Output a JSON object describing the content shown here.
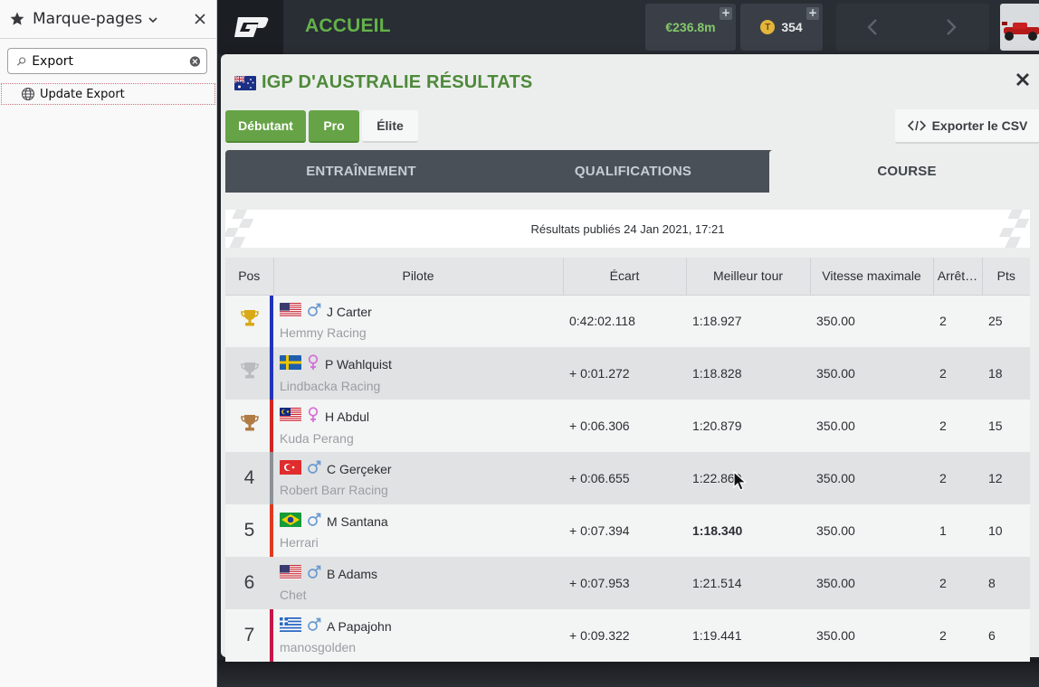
{
  "sidebar": {
    "title": "Marque-pages",
    "search": {
      "value": "Export",
      "placeholder": ""
    },
    "items": [
      {
        "label": "Update Export"
      }
    ]
  },
  "topbar": {
    "page_title": "ACCUEIL",
    "money": "€236.8m",
    "tokens": "354",
    "plus": "+"
  },
  "modal": {
    "title": "IGP D'AUSTRALIE RÉSULTATS",
    "levels": [
      "Débutant",
      "Pro",
      "Élite"
    ],
    "export_label": "Exporter le CSV",
    "tabs": [
      "ENTRAÎNEMENT",
      "QUALIFICATIONS",
      "COURSE"
    ],
    "active_tab": "COURSE",
    "published": "Résultats publiés 24 Jan 2021, 17:21"
  },
  "table": {
    "headers": [
      "Pos",
      "Pilote",
      "Écart",
      "Meilleur tour",
      "Vitesse maximale",
      "Arrêt…",
      "Pts"
    ],
    "rows": [
      {
        "pos": "",
        "trophy": "gold",
        "flag": "us",
        "gender": "male",
        "driver": "J Carter",
        "team": "Hemmy Racing",
        "team_color": "#2233bb",
        "gap": "0:42:02.118",
        "best_lap": "1:18.927",
        "fastest": false,
        "speed": "350.00",
        "stops": "2",
        "pts": "25"
      },
      {
        "pos": "",
        "trophy": "silver",
        "flag": "se",
        "gender": "female",
        "driver": "P Wahlquist",
        "team": "Lindbacka Racing",
        "team_color": "#2233bb",
        "gap": "+ 0:01.272",
        "best_lap": "1:18.828",
        "fastest": false,
        "speed": "350.00",
        "stops": "2",
        "pts": "18"
      },
      {
        "pos": "",
        "trophy": "bronze",
        "flag": "my",
        "gender": "female",
        "driver": "H Abdul",
        "team": "Kuda Perang",
        "team_color": "#d42424",
        "gap": "+ 0:06.306",
        "best_lap": "1:20.879",
        "fastest": false,
        "speed": "350.00",
        "stops": "2",
        "pts": "15"
      },
      {
        "pos": "4",
        "trophy": "",
        "flag": "tr",
        "gender": "male",
        "driver": "C Gerçeker",
        "team": "Robert Barr Racing",
        "team_color": "#8c9197",
        "gap": "+ 0:06.655",
        "best_lap": "1:22.869",
        "fastest": false,
        "speed": "350.00",
        "stops": "2",
        "pts": "12"
      },
      {
        "pos": "5",
        "trophy": "",
        "flag": "br",
        "gender": "male",
        "driver": "M Santana",
        "team": "Herrari",
        "team_color": "#e03a1e",
        "gap": "+ 0:07.394",
        "best_lap": "1:18.340",
        "fastest": true,
        "speed": "350.00",
        "stops": "1",
        "pts": "10"
      },
      {
        "pos": "6",
        "trophy": "",
        "flag": "us",
        "gender": "male",
        "driver": "B Adams",
        "team": "Chet",
        "team_color": "#e0e2e3",
        "gap": "+ 0:07.953",
        "best_lap": "1:21.514",
        "fastest": false,
        "speed": "350.00",
        "stops": "2",
        "pts": "8"
      },
      {
        "pos": "7",
        "trophy": "",
        "flag": "gr",
        "gender": "male",
        "driver": "A Papajohn",
        "team": "manosgolden",
        "team_color": "#c8154a",
        "gap": "+ 0:09.322",
        "best_lap": "1:19.441",
        "fastest": false,
        "speed": "350.00",
        "stops": "2",
        "pts": "6"
      }
    ]
  }
}
